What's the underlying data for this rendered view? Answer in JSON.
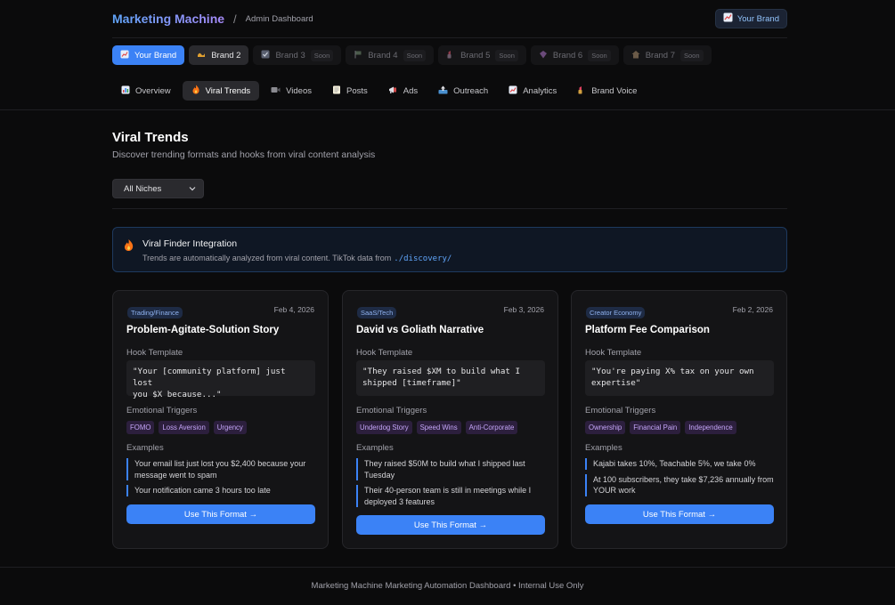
{
  "header": {
    "app_title": "Marketing Machine",
    "separator": "/",
    "subtitle": "Admin Dashboard",
    "brand_button": "Your Brand"
  },
  "brand_tabs": [
    {
      "label": "Your Brand",
      "icon": "chart-icon",
      "state": "active"
    },
    {
      "label": "Brand 2",
      "icon": "wave-icon",
      "state": "normal"
    },
    {
      "label": "Brand 3",
      "icon": "check-box-icon",
      "state": "disabled",
      "badge": "Soon"
    },
    {
      "label": "Brand 4",
      "icon": "flag-icon",
      "state": "disabled",
      "badge": "Soon"
    },
    {
      "label": "Brand 5",
      "icon": "lipstick-icon",
      "state": "disabled",
      "badge": "Soon"
    },
    {
      "label": "Brand 6",
      "icon": "gem-icon",
      "state": "disabled",
      "badge": "Soon"
    },
    {
      "label": "Brand 7",
      "icon": "house-icon",
      "state": "disabled",
      "badge": "Soon"
    }
  ],
  "nav_tabs": [
    {
      "label": "Overview",
      "icon": "bar-chart-icon"
    },
    {
      "label": "Viral Trends",
      "icon": "fire-icon",
      "active": true
    },
    {
      "label": "Videos",
      "icon": "video-icon"
    },
    {
      "label": "Posts",
      "icon": "memo-icon"
    },
    {
      "label": "Ads",
      "icon": "megaphone-icon"
    },
    {
      "label": "Outreach",
      "icon": "outbox-icon"
    },
    {
      "label": "Analytics",
      "icon": "line-chart-icon"
    },
    {
      "label": "Brand Voice",
      "icon": "lipstick-icon"
    }
  ],
  "page": {
    "title": "Viral Trends",
    "description": "Discover trending formats and hooks from viral content analysis",
    "filter": {
      "selected": "All Niches"
    }
  },
  "banner": {
    "title": "Viral Finder Integration",
    "text": "Trends are automatically analyzed from viral content. TikTok data from",
    "path": "./discovery/"
  },
  "cards": [
    {
      "tag": "Trading/Finance",
      "date": "Feb 4, 2026",
      "title": "Problem-Agitate-Solution Story",
      "hook_label": "Hook Template",
      "hook": "\"Your [community platform] just lost\nyou $X because...\"",
      "triggers_label": "Emotional Triggers",
      "triggers": [
        "FOMO",
        "Loss Aversion",
        "Urgency"
      ],
      "examples_label": "Examples",
      "examples": [
        "Your email list just lost you $2,400 because your message went to spam",
        "Your notification came 3 hours too late"
      ],
      "cta": "Use This Format →"
    },
    {
      "tag": "SaaS/Tech",
      "date": "Feb 3, 2026",
      "title": "David vs Goliath Narrative",
      "hook_label": "Hook Template",
      "hook": "\"They raised $XM to build what I\nshipped [timeframe]\"",
      "triggers_label": "Emotional Triggers",
      "triggers": [
        "Underdog Story",
        "Speed Wins",
        "Anti-Corporate"
      ],
      "examples_label": "Examples",
      "examples": [
        "They raised $50M to build what I shipped last Tuesday",
        "Their 40-person team is still in meetings while I deployed 3 features"
      ],
      "cta": "Use This Format →"
    },
    {
      "tag": "Creator Economy",
      "date": "Feb 2, 2026",
      "title": "Platform Fee Comparison",
      "hook_label": "Hook Template",
      "hook": "\"You're paying X% tax on your own\nexpertise\"",
      "triggers_label": "Emotional Triggers",
      "triggers": [
        "Ownership",
        "Financial Pain",
        "Independence"
      ],
      "examples_label": "Examples",
      "examples": [
        "Kajabi takes 10%, Teachable 5%, we take 0%",
        "At 100 subscribers, they take $7,236 annually from YOUR work"
      ],
      "cta": "Use This Format →"
    }
  ],
  "footer": {
    "text": "Marketing Machine Marketing Automation Dashboard • Internal Use Only"
  },
  "colors": {
    "accent": "#3b82f6",
    "background": "#0b0b0c",
    "card": "#141416",
    "trigger": "#c4a5f8"
  }
}
